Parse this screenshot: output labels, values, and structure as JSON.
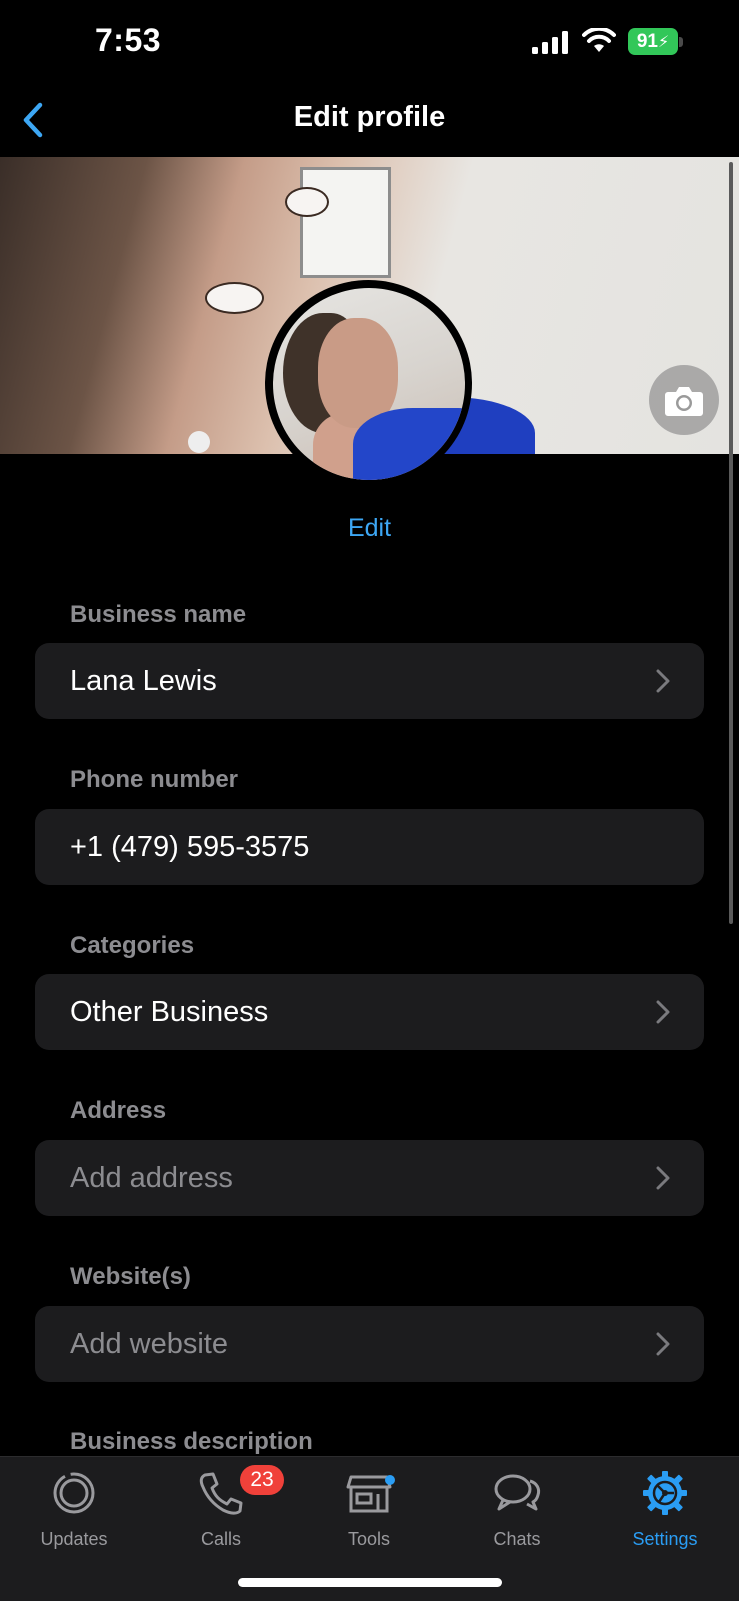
{
  "status_bar": {
    "time": "7:53",
    "battery": "91",
    "signal_icon": "cellular-signal-icon",
    "wifi_icon": "wifi-icon",
    "battery_color": "#32c759"
  },
  "nav": {
    "title": "Edit profile",
    "back_icon": "chevron-left-icon",
    "accent": "#3da7f4"
  },
  "profile": {
    "edit_label": "Edit",
    "camera_icon": "camera-icon"
  },
  "fields": [
    {
      "label": "Business name",
      "value": "Lana Lewis",
      "placeholder": false,
      "chevron": true
    },
    {
      "label": "Phone number",
      "value": "+1 (479) 595-3575",
      "placeholder": false,
      "chevron": false
    },
    {
      "label": "Categories",
      "value": "Other Business",
      "placeholder": false,
      "chevron": true
    },
    {
      "label": "Address",
      "value": "Add address",
      "placeholder": true,
      "chevron": true
    },
    {
      "label": "Website(s)",
      "value": "Add website",
      "placeholder": true,
      "chevron": true
    },
    {
      "label": "Business description"
    }
  ],
  "tabbar": {
    "tabs": [
      {
        "label": "Updates",
        "icon": "updates-icon"
      },
      {
        "label": "Calls",
        "icon": "phone-icon",
        "badge": "23"
      },
      {
        "label": "Tools",
        "icon": "storefront-icon"
      },
      {
        "label": "Chats",
        "icon": "chat-bubbles-icon"
      },
      {
        "label": "Settings",
        "icon": "settings-gear-icon",
        "active": true
      }
    ],
    "active_color": "#2a9df4",
    "badge_color": "#f0413a"
  }
}
